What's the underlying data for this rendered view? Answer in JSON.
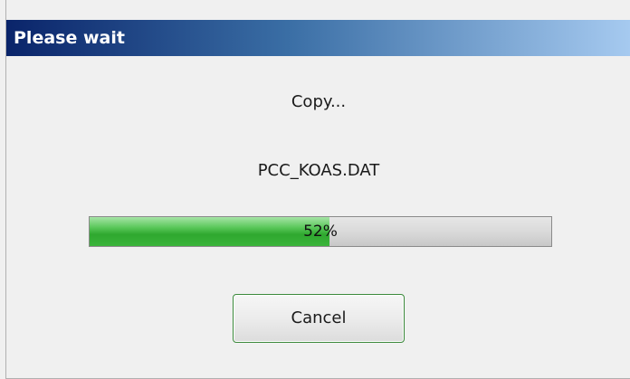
{
  "dialog": {
    "title": "Please wait",
    "operation_text": "Copy...",
    "file_name": "PCC_KOAS.DAT",
    "progress": {
      "percent": 52,
      "label": "52%",
      "fill_color": "#3ab43a"
    },
    "cancel_label": "Cancel"
  }
}
